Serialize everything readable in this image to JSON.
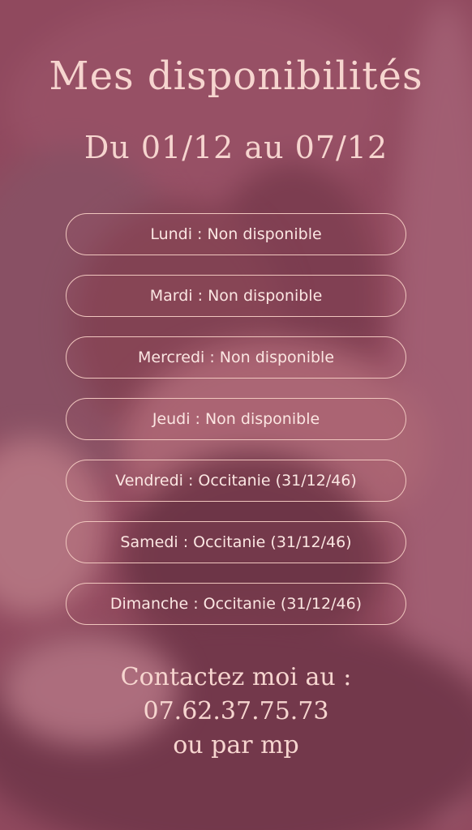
{
  "header": {
    "title": "Mes disponibilités",
    "subtitle": "Du 01/12 au 07/12"
  },
  "days": [
    {
      "label": "Lundi : Non disponible"
    },
    {
      "label": "Mardi : Non disponible"
    },
    {
      "label": "Mercredi : Non disponible"
    },
    {
      "label": "Jeudi : Non disponible"
    },
    {
      "label": "Vendredi : Occitanie (31/12/46)"
    },
    {
      "label": "Samedi : Occitanie (31/12/46)"
    },
    {
      "label": "Dimanche : Occitanie (31/12/46)"
    }
  ],
  "contact": {
    "line1": "Contactez moi au :",
    "phone": "07.62.37.75.73",
    "line3": "ou par mp"
  },
  "colors": {
    "overlay": "#964860",
    "text": "#f6d5cf",
    "pill_border": "#f0c6be"
  }
}
